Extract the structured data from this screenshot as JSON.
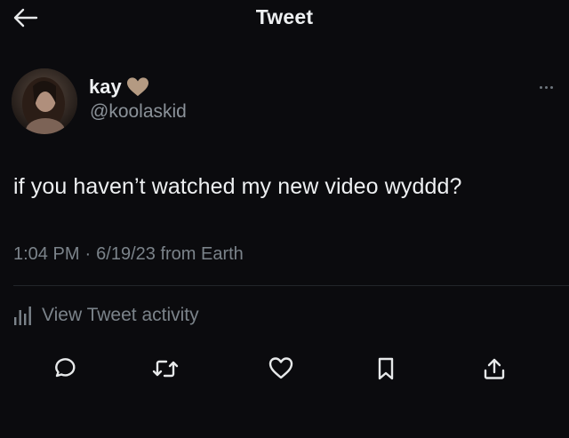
{
  "header": {
    "title": "Tweet",
    "back_icon": "arrow-left-icon"
  },
  "author": {
    "display_name": "kay",
    "name_emoji": "light-brown-heart",
    "handle": "@koolaskid"
  },
  "tweet": {
    "text": "if you haven’t watched my new video wyddd?",
    "time": "1:04 PM",
    "separator": "·",
    "date_source": "6/19/23 from Earth"
  },
  "activity": {
    "label": "View Tweet activity",
    "icon": "bar-chart-icon"
  },
  "actions": [
    "reply-icon",
    "retweet-icon",
    "like-icon",
    "bookmark-icon",
    "share-icon"
  ],
  "colors": {
    "background": "#0b0b0e",
    "primary_text": "#eef0f2",
    "secondary_text": "#7b838a",
    "icon": "#e7e9ea"
  }
}
